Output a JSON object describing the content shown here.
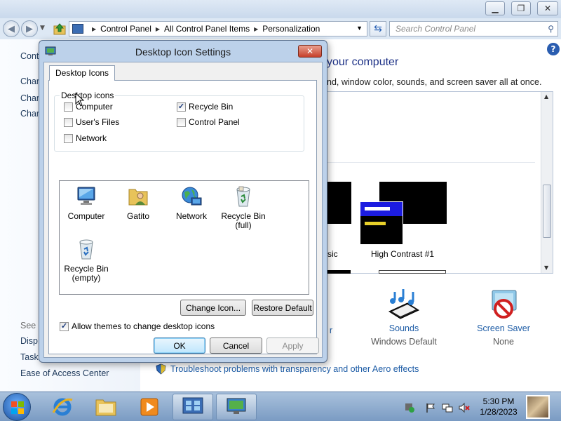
{
  "explorer": {
    "breadcrumb": [
      "Control Panel",
      "All Control Panel Items",
      "Personalization"
    ],
    "search_placeholder": "Search Control Panel",
    "left_pane": {
      "control_panel_home": "Cont",
      "links": [
        "Char",
        "Char",
        "Char"
      ],
      "see_also": "See a",
      "see_also_links": [
        "Disp",
        "Task",
        "Ease of Access Center"
      ]
    },
    "main_title": "your computer",
    "main_subtitle": "nd, window color, sounds, and screen saver all at once.",
    "themes": [
      {
        "label": "sic"
      },
      {
        "label": "High Contrast #1"
      }
    ],
    "bottom_items": [
      {
        "link": "r",
        "value": ""
      },
      {
        "link": "Sounds",
        "value": "Windows Default"
      },
      {
        "link": "Screen Saver",
        "value": "None"
      }
    ],
    "troubleshoot_link": "Troubleshoot problems with transparency and other Aero effects"
  },
  "dialog": {
    "title": "Desktop Icon Settings",
    "close_glyph": "✕",
    "tab": "Desktop Icons",
    "group_label": "Desktop icons",
    "checkboxes": [
      {
        "label": "Computer",
        "checked": false
      },
      {
        "label": "Recycle Bin",
        "checked": true
      },
      {
        "label": "User's Files",
        "checked": false
      },
      {
        "label": "Control Panel",
        "checked": false
      },
      {
        "label": "Network",
        "checked": false
      }
    ],
    "icons": [
      {
        "line1": "Computer",
        "line2": ""
      },
      {
        "line1": "Gatito",
        "line2": ""
      },
      {
        "line1": "Network",
        "line2": ""
      },
      {
        "line1": "Recycle Bin",
        "line2": "(full)"
      },
      {
        "line1": "Recycle Bin",
        "line2": "(empty)"
      }
    ],
    "change_icon_btn": "Change Icon...",
    "restore_default_btn": "Restore Default",
    "allow_themes": {
      "label": "Allow themes to change desktop icons",
      "checked": true
    },
    "ok_btn": "OK",
    "cancel_btn": "Cancel",
    "apply_btn": "Apply"
  },
  "taskbar": {
    "time": "5:30 PM",
    "date": "1/28/2023"
  },
  "colors": {
    "link_blue": "#1d5ca6",
    "title_blue": "#1e3287",
    "dialog_frame": "#bcd1ea",
    "close_red": "#c6402b"
  }
}
